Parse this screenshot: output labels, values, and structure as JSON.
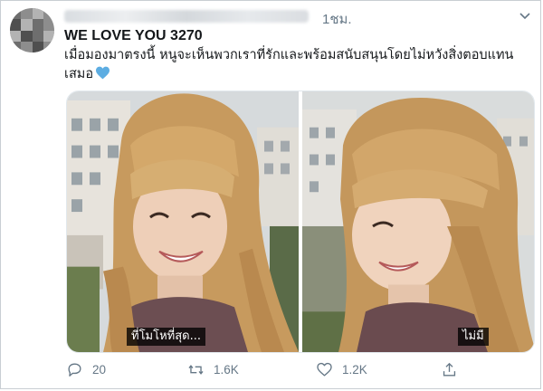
{
  "tweet": {
    "timestamp": "1ชม.",
    "display_name": "WE LOVE YOU 3270",
    "text": "เมื่อมองมาตรงนี้ หนูจะเห็นพวกเราที่รักและพร้อมสนับสนุนโดยไม่หวังสิ่งตอบแทน เสมอ",
    "heart_emoji": "blue-heart-icon"
  },
  "media": {
    "left_caption": "ที่โมโหที่สุด...",
    "right_caption": "ไม่มี"
  },
  "actions": {
    "reply_count": "20",
    "retweet_count": "1.6K",
    "like_count": "1.2K"
  },
  "colors": {
    "text": "#14171a",
    "muted": "#657786",
    "heart": "#5dade2"
  }
}
